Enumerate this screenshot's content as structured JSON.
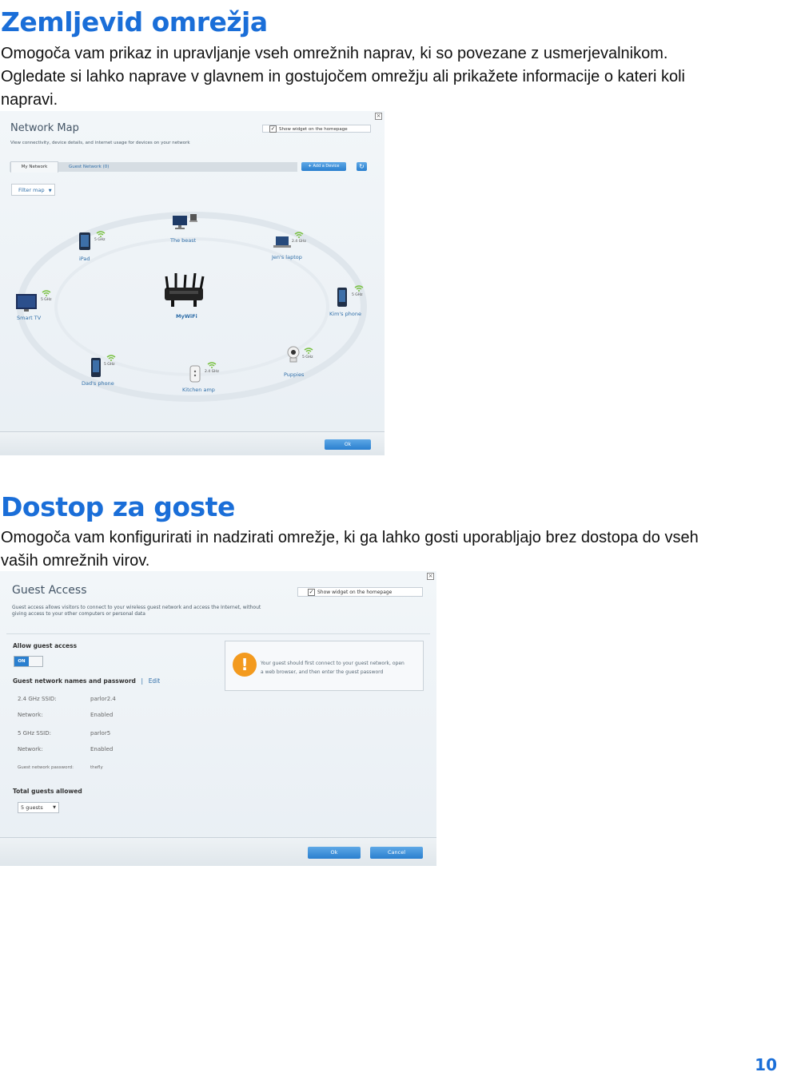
{
  "section1": {
    "title": "Zemljevid omrežja",
    "line1": "Omogoča vam prikaz in upravljanje vseh omrežnih naprav, ki so povezane z usmerjevalnikom.",
    "line2": "Ogledate si lahko naprave v glavnem in gostujočem omrežju ali prikažete informacije o kateri koli",
    "line3": "napravi."
  },
  "network_map": {
    "title": "Network Map",
    "subtitle": "View connectivity, device details, and internet usage for devices on your network",
    "widget_checkbox": "Show widget on the homepage",
    "tab_my_network": "My Network",
    "tab_guest_network": "Guest Network (0)",
    "add_device_label": "Add a Device",
    "filter_label": "Filter map",
    "router_label": "MyWiFi",
    "ok_label": "Ok",
    "devices": [
      {
        "name": "iPad",
        "band": "5 GHz",
        "icon": "tablet-icon"
      },
      {
        "name": "The beast",
        "band": "",
        "icon": "desktop-computer-icon"
      },
      {
        "name": "Jen's laptop",
        "band": "2.4 GHz",
        "icon": "laptop-icon"
      },
      {
        "name": "Smart TV",
        "band": "5 GHz",
        "icon": "tv-icon"
      },
      {
        "name": "Kim's phone",
        "band": "5 GHz",
        "icon": "phone-icon"
      },
      {
        "name": "Dad's phone",
        "band": "5 GHz",
        "icon": "phone-icon"
      },
      {
        "name": "Kitchen amp",
        "band": "2.4 GHz",
        "icon": "smart-plug-icon"
      },
      {
        "name": "Puppies",
        "band": "5 GHz",
        "icon": "camera-icon"
      }
    ]
  },
  "section2": {
    "title": "Dostop za goste",
    "line1": "Omogoča vam konfigurirati in nadzirati omrežje, ki ga lahko gosti uporabljajo brez dostopa do vseh",
    "line2": "vaših omrežnih virov."
  },
  "guest_access": {
    "title": "Guest Access",
    "widget_checkbox": "Show widget on the homepage",
    "desc1": "Guest access allows visitors to connect to your wireless guest network and access the Internet, without",
    "desc2": "giving access to your other computers or personal data",
    "allow_label": "Allow guest access",
    "toggle_state": "ON",
    "names_label": "Guest network names and password",
    "edit_label": "Edit",
    "rows": [
      {
        "label": "2.4 GHz SSID:",
        "value": "parlor2.4"
      },
      {
        "label": "Network:",
        "value": "Enabled"
      },
      {
        "label": "5 GHz SSID:",
        "value": "parlor5"
      },
      {
        "label": "Network:",
        "value": "Enabled"
      },
      {
        "label": "Guest network password:",
        "value": "thefly"
      }
    ],
    "total_label": "Total guests allowed",
    "guests_value": "5 guests",
    "warning_line1": "Your guest should first connect to your guest network, open",
    "warning_line2": "a web browser, and then enter the guest password",
    "ok_label": "Ok",
    "cancel_label": "Cancel"
  },
  "page_number": "10",
  "colors": {
    "heading_blue": "#1a6ed8",
    "button_blue": "#2a7fcf",
    "warning_orange": "#f39a1e"
  }
}
